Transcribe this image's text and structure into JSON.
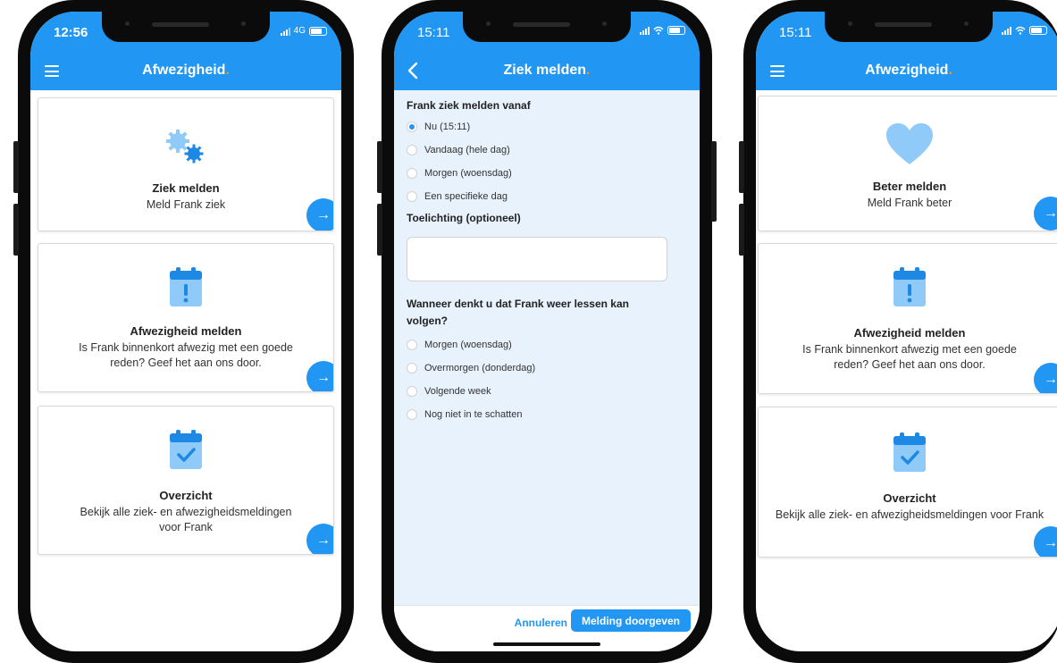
{
  "colors": {
    "brand": "#2196f3",
    "accent": "#ff9800",
    "form_background": "#e8f2fc",
    "icon_light": "#90caf9"
  },
  "phone1": {
    "status": {
      "time": "12:56",
      "network": "4G"
    },
    "app_title": "Afwezigheid",
    "title_accent": ".",
    "cards": [
      {
        "icon": "gears-icon",
        "title": "Ziek melden",
        "description": "Meld Frank ziek"
      },
      {
        "icon": "calendar-exclamation-icon",
        "title": "Afwezigheid melden",
        "description": "Is Frank binnenkort afwezig met een goede reden? Geef het aan ons door."
      },
      {
        "icon": "calendar-check-icon",
        "title": "Overzicht",
        "description": "Bekijk alle ziek- en afwezigheidsmeldingen voor Frank"
      }
    ]
  },
  "phone2": {
    "status": {
      "time": "15:11"
    },
    "app_title": "Ziek melden",
    "title_accent": ".",
    "question1": "Frank ziek melden vanaf",
    "options1": [
      "Nu (15:11)",
      "Vandaag (hele dag)",
      "Morgen (woensdag)",
      "Een specifieke dag"
    ],
    "selected1": 0,
    "comment_label": "Toelichting (optioneel)",
    "comment_value": "",
    "question2": "Wanneer denkt u dat Frank weer lessen kan volgen?",
    "options2": [
      "Morgen (woensdag)",
      "Overmorgen (donderdag)",
      "Volgende week",
      "Nog niet in te schatten"
    ],
    "cancel_label": "Annuleren",
    "submit_label": "Melding doorgeven"
  },
  "phone3": {
    "status": {
      "time": "15:11"
    },
    "app_title": "Afwezigheid",
    "title_accent": ".",
    "cards": [
      {
        "icon": "heart-icon",
        "title": "Beter melden",
        "description": "Meld Frank beter"
      },
      {
        "icon": "calendar-exclamation-icon",
        "title": "Afwezigheid melden",
        "description": "Is Frank binnenkort afwezig met een goede reden? Geef het aan ons door."
      },
      {
        "icon": "calendar-check-icon",
        "title": "Overzicht",
        "description": "Bekijk alle ziek- en afwezigheidsmeldingen voor Frank"
      }
    ]
  }
}
